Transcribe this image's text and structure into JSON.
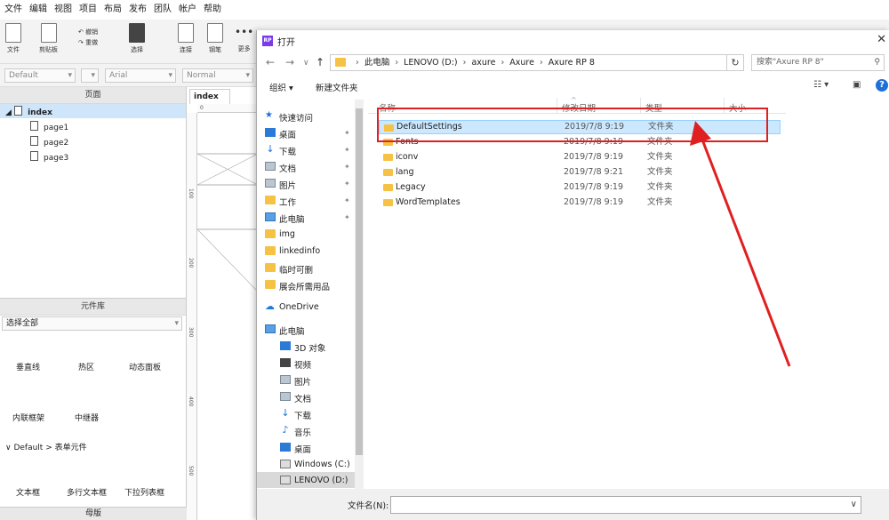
{
  "menubar": [
    "文件",
    "编辑",
    "视图",
    "项目",
    "布局",
    "发布",
    "团队",
    "帐户",
    "帮助"
  ],
  "toolbar": {
    "file_label": "文件",
    "clipboard_label": "剪贴板",
    "undo_label": "撤销",
    "redo_label": "重做",
    "select_label": "选择",
    "connect_label": "连接",
    "pen_label": "钢笔",
    "more_label": "更多"
  },
  "stylebar": {
    "style_value": "Default",
    "font_value": "Arial",
    "weight_value": "Normal"
  },
  "pages_panel": {
    "title": "页面",
    "root": "index",
    "pages": [
      "page1",
      "page2",
      "page3"
    ]
  },
  "widgets_panel": {
    "title": "元件库",
    "library_select": "选择全部",
    "items_row1": [
      "垂直线",
      "热区",
      "动态面板"
    ],
    "items_row2": [
      "内联框架",
      "中继器"
    ],
    "section": "Default > 表单元件",
    "items_row3": [
      "文本框",
      "多行文本框",
      "下拉列表框"
    ]
  },
  "master_panel": {
    "title": "母版"
  },
  "canvas": {
    "tab_label": "index",
    "ruler_h": [
      "0"
    ],
    "ruler_v": [
      "100",
      "200",
      "300",
      "400",
      "500"
    ]
  },
  "dialog": {
    "title": "打开",
    "address": [
      "此电脑",
      "LENOVO (D:)",
      "axure",
      "Axure",
      "Axure RP 8"
    ],
    "search_placeholder": "搜索\"Axure RP 8\"",
    "organize_label": "组织 ▾",
    "new_folder_label": "新建文件夹",
    "nav": {
      "quick_access": "快速访问",
      "pinned": [
        "桌面",
        "下载",
        "文档",
        "图片",
        "工作",
        "此电脑"
      ],
      "recent": [
        "img",
        "linkedinfo",
        "临时可删",
        "展会所需用品"
      ],
      "onedrive": "OneDrive",
      "this_pc": "此电脑",
      "pc_items": [
        "3D 对象",
        "视频",
        "图片",
        "文档",
        "下载",
        "音乐",
        "桌面",
        "Windows (C:)",
        "LENOVO (D:)"
      ]
    },
    "columns": {
      "name": "名称",
      "date": "修改日期",
      "type": "类型",
      "size": "大小"
    },
    "files": [
      {
        "name": "DefaultSettings",
        "date": "2019/7/8 9:19",
        "type": "文件夹",
        "selected": true
      },
      {
        "name": "Fonts",
        "date": "2019/7/8 9:19",
        "type": "文件夹"
      },
      {
        "name": "iconv",
        "date": "2019/7/8 9:19",
        "type": "文件夹"
      },
      {
        "name": "lang",
        "date": "2019/7/8 9:21",
        "type": "文件夹"
      },
      {
        "name": "Legacy",
        "date": "2019/7/8 9:19",
        "type": "文件夹"
      },
      {
        "name": "WordTemplates",
        "date": "2019/7/8 9:19",
        "type": "文件夹"
      }
    ],
    "filename_label": "文件名(N):",
    "filename_value": ""
  },
  "colors": {
    "highlight": "#e02020",
    "selection": "#cce8ff",
    "folder": "#f6c244",
    "accent": "#1e6fd9"
  }
}
